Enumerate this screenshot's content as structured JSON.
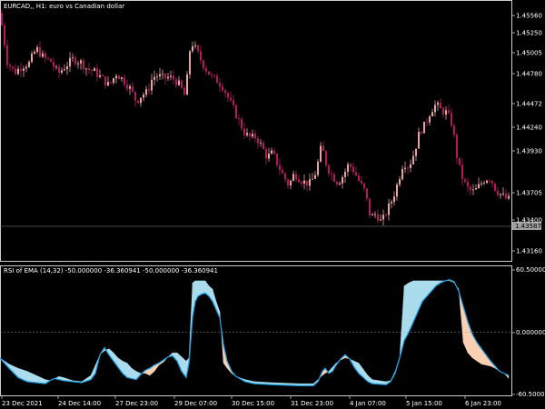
{
  "header": {
    "main_title": "EURCAD,, H1:  euro vs Canadian dollar",
    "indicator_title": "RSI of EMA (14,32) -50.000000 -36.360941 -50.000000 -36.360941"
  },
  "price_axis": {
    "labels": [
      "1.45560",
      "1.45250",
      "1.45005",
      "1.44780",
      "1.44472",
      "1.44240",
      "1.43930",
      "1.43705",
      "1.43400",
      "1.43160"
    ],
    "last_price": "1.43587"
  },
  "indicator_axis": {
    "labels": [
      "60.500000",
      "0.000000",
      "-60.500000"
    ]
  },
  "time_axis": {
    "labels": [
      "23 Dec 2021",
      "24 Dec 14:00",
      "27 Dec 23:00",
      "29 Dec 07:00",
      "30 Dec 15:00",
      "31 Dec 23:00",
      "4 Jan 07:00",
      "5 Jan 15:00",
      "6 Jan 23:00"
    ]
  },
  "colors": {
    "background": "#000000",
    "grid": "#333333",
    "axis": "#ffffff",
    "bull_candle": "#e8a2a2",
    "bear_candle": "#b3185c",
    "rsi_line": "#1c9fe0",
    "rsi_line_secondary": "#f5b283",
    "cloud_up": "#aadcec",
    "cloud_down": "#fbd0b3",
    "price_line": "#8a8a8a",
    "price_tag": "#a0a0a0"
  },
  "chart_data": [
    {
      "type": "candlestick",
      "title": "EURCAD,, H1:  euro vs Canadian dollar",
      "ylim": [
        1.4295,
        1.4572
      ],
      "price_anchors": [
        [
          0,
          1.456
        ],
        [
          8,
          1.4508
        ],
        [
          16,
          1.4496
        ],
        [
          24,
          1.4503
        ],
        [
          32,
          1.4506
        ],
        [
          40,
          1.4522
        ],
        [
          48,
          1.4512
        ],
        [
          56,
          1.4508
        ],
        [
          64,
          1.4495
        ],
        [
          72,
          1.4503
        ],
        [
          80,
          1.451
        ],
        [
          88,
          1.4508
        ],
        [
          96,
          1.45
        ],
        [
          104,
          1.4497
        ],
        [
          112,
          1.449
        ],
        [
          120,
          1.4482
        ],
        [
          128,
          1.4495
        ],
        [
          136,
          1.4488
        ],
        [
          144,
          1.4478
        ],
        [
          150,
          1.4465
        ],
        [
          156,
          1.4472
        ],
        [
          162,
          1.4475
        ],
        [
          168,
          1.4491
        ],
        [
          174,
          1.4493
        ],
        [
          180,
          1.449
        ],
        [
          186,
          1.4491
        ],
        [
          192,
          1.4489
        ],
        [
          198,
          1.4482
        ],
        [
          204,
          1.447
        ],
        [
          210,
          1.453
        ],
        [
          216,
          1.452
        ],
        [
          222,
          1.4508
        ],
        [
          228,
          1.4498
        ],
        [
          234,
          1.449
        ],
        [
          240,
          1.4487
        ],
        [
          246,
          1.448
        ],
        [
          252,
          1.4467
        ],
        [
          258,
          1.4455
        ],
        [
          264,
          1.4442
        ],
        [
          270,
          1.443
        ],
        [
          276,
          1.4426
        ],
        [
          282,
          1.4427
        ],
        [
          288,
          1.4417
        ],
        [
          294,
          1.4405
        ],
        [
          300,
          1.441
        ],
        [
          306,
          1.4397
        ],
        [
          312,
          1.4385
        ],
        [
          318,
          1.4375
        ],
        [
          324,
          1.4388
        ],
        [
          330,
          1.4382
        ],
        [
          336,
          1.4378
        ],
        [
          342,
          1.4377
        ],
        [
          348,
          1.439
        ],
        [
          354,
          1.4418
        ],
        [
          360,
          1.4395
        ],
        [
          366,
          1.4385
        ],
        [
          372,
          1.4378
        ],
        [
          378,
          1.4386
        ],
        [
          384,
          1.4398
        ],
        [
          390,
          1.439
        ],
        [
          396,
          1.4378
        ],
        [
          402,
          1.4368
        ],
        [
          408,
          1.434
        ],
        [
          414,
          1.4345
        ],
        [
          420,
          1.4335
        ],
        [
          426,
          1.4348
        ],
        [
          432,
          1.436
        ],
        [
          438,
          1.4378
        ],
        [
          444,
          1.44
        ],
        [
          450,
          1.4395
        ],
        [
          456,
          1.441
        ],
        [
          462,
          1.4433
        ],
        [
          468,
          1.444
        ],
        [
          474,
          1.4455
        ],
        [
          480,
          1.4462
        ],
        [
          486,
          1.4455
        ],
        [
          492,
          1.4453
        ],
        [
          498,
          1.444
        ],
        [
          504,
          1.44
        ],
        [
          510,
          1.438
        ],
        [
          516,
          1.437
        ],
        [
          522,
          1.4368
        ],
        [
          528,
          1.4375
        ],
        [
          534,
          1.4382
        ],
        [
          540,
          1.4383
        ],
        [
          546,
          1.437
        ],
        [
          552,
          1.4365
        ],
        [
          558,
          1.436
        ]
      ]
    },
    {
      "type": "area",
      "title": "RSI of EMA (14,32) -50.000000 -36.360941 -50.000000 -36.360941",
      "ylim": [
        -60.5,
        60.5
      ],
      "reference_line": 0,
      "series": [
        {
          "values": [
            [
              0,
              -25
            ],
            [
              10,
              -35
            ],
            [
              20,
              -44
            ],
            [
              30,
              -48
            ],
            [
              40,
              -49
            ],
            [
              50,
              -50
            ],
            [
              55,
              -47
            ],
            [
              60,
              -45
            ],
            [
              65,
              -46
            ],
            [
              70,
              -47
            ],
            [
              80,
              -48
            ],
            [
              90,
              -49
            ],
            [
              100,
              -46
            ],
            [
              105,
              -40
            ],
            [
              110,
              -22
            ],
            [
              115,
              -15
            ],
            [
              120,
              -22
            ],
            [
              125,
              -28
            ],
            [
              130,
              -34
            ],
            [
              135,
              -40
            ],
            [
              140,
              -44
            ],
            [
              145,
              -45
            ],
            [
              150,
              -46
            ],
            [
              155,
              -41
            ],
            [
              160,
              -37
            ],
            [
              165,
              -35
            ],
            [
              170,
              -32
            ],
            [
              175,
              -30
            ],
            [
              180,
              -27
            ],
            [
              185,
              -24
            ],
            [
              190,
              -23
            ],
            [
              195,
              -28
            ],
            [
              200,
              -38
            ],
            [
              205,
              -44
            ],
            [
              208,
              -30
            ],
            [
              212,
              15
            ],
            [
              215,
              30
            ],
            [
              218,
              35
            ],
            [
              222,
              37
            ],
            [
              226,
              38
            ],
            [
              230,
              35
            ],
            [
              234,
              30
            ],
            [
              238,
              22
            ],
            [
              242,
              14
            ],
            [
              246,
              -12
            ],
            [
              250,
              -28
            ],
            [
              255,
              -38
            ],
            [
              260,
              -43
            ],
            [
              270,
              -48
            ],
            [
              280,
              -50
            ],
            [
              300,
              -51
            ],
            [
              330,
              -52
            ],
            [
              345,
              -52
            ],
            [
              350,
              -48
            ],
            [
              355,
              -38
            ],
            [
              358,
              -35
            ],
            [
              362,
              -40
            ],
            [
              366,
              -38
            ],
            [
              370,
              -32
            ],
            [
              375,
              -26
            ],
            [
              380,
              -22
            ],
            [
              385,
              -26
            ],
            [
              390,
              -34
            ],
            [
              395,
              -40
            ],
            [
              400,
              -44
            ],
            [
              405,
              -48
            ],
            [
              410,
              -50
            ],
            [
              425,
              -51
            ],
            [
              430,
              -48
            ],
            [
              435,
              -40
            ],
            [
              440,
              -25
            ],
            [
              445,
              -8
            ],
            [
              450,
              0
            ],
            [
              455,
              10
            ],
            [
              460,
              20
            ],
            [
              465,
              30
            ],
            [
              470,
              35
            ],
            [
              475,
              40
            ],
            [
              480,
              45
            ],
            [
              485,
              48
            ],
            [
              490,
              50
            ],
            [
              495,
              51
            ],
            [
              500,
              49
            ],
            [
              505,
              40
            ],
            [
              510,
              25
            ],
            [
              515,
              10
            ],
            [
              520,
              -2
            ],
            [
              525,
              -10
            ],
            [
              530,
              -16
            ],
            [
              535,
              -22
            ],
            [
              540,
              -28
            ],
            [
              545,
              -33
            ],
            [
              550,
              -38
            ],
            [
              555,
              -40
            ],
            [
              560,
              -42
            ]
          ]
        },
        {
          "values": [
            [
              0,
              -25
            ],
            [
              10,
              -31
            ],
            [
              20,
              -35
            ],
            [
              30,
              -38
            ],
            [
              40,
              -42
            ],
            [
              50,
              -46
            ],
            [
              55,
              -47
            ],
            [
              60,
              -45
            ],
            [
              65,
              -43
            ],
            [
              70,
              -44
            ],
            [
              80,
              -47
            ],
            [
              90,
              -48
            ],
            [
              100,
              -42
            ],
            [
              105,
              -32
            ],
            [
              110,
              -22
            ],
            [
              115,
              -18
            ],
            [
              120,
              -16
            ],
            [
              125,
              -20
            ],
            [
              130,
              -25
            ],
            [
              135,
              -28
            ],
            [
              140,
              -30
            ],
            [
              145,
              -35
            ],
            [
              150,
              -38
            ],
            [
              155,
              -40
            ],
            [
              160,
              -40
            ],
            [
              165,
              -42
            ],
            [
              170,
              -38
            ],
            [
              175,
              -32
            ],
            [
              180,
              -29
            ],
            [
              185,
              -24
            ],
            [
              190,
              -20
            ],
            [
              195,
              -20
            ],
            [
              200,
              -24
            ],
            [
              205,
              -28
            ],
            [
              208,
              -25
            ],
            [
              212,
              48
            ],
            [
              215,
              50
            ],
            [
              218,
              50
            ],
            [
              222,
              50
            ],
            [
              226,
              50
            ],
            [
              230,
              45
            ],
            [
              234,
              42
            ],
            [
              238,
              30
            ],
            [
              242,
              20
            ],
            [
              246,
              -30
            ],
            [
              250,
              -35
            ],
            [
              255,
              -40
            ],
            [
              260,
              -43
            ],
            [
              270,
              -46
            ],
            [
              280,
              -48
            ],
            [
              300,
              -49
            ],
            [
              330,
              -50
            ],
            [
              345,
              -50
            ],
            [
              350,
              -46
            ],
            [
              355,
              -42
            ],
            [
              358,
              -40
            ],
            [
              362,
              -38
            ],
            [
              366,
              -34
            ],
            [
              370,
              -30
            ],
            [
              375,
              -27
            ],
            [
              380,
              -25
            ],
            [
              385,
              -26
            ],
            [
              390,
              -28
            ],
            [
              395,
              -30
            ],
            [
              400,
              -36
            ],
            [
              405,
              -42
            ],
            [
              410,
              -46
            ],
            [
              425,
              -48
            ],
            [
              430,
              -47
            ],
            [
              435,
              -38
            ],
            [
              440,
              -24
            ],
            [
              445,
              45
            ],
            [
              450,
              48
            ],
            [
              455,
              50
            ],
            [
              460,
              50
            ],
            [
              465,
              50
            ],
            [
              470,
              50
            ],
            [
              475,
              50
            ],
            [
              480,
              50
            ],
            [
              485,
              50
            ],
            [
              490,
              50
            ],
            [
              495,
              50
            ],
            [
              500,
              48
            ],
            [
              505,
              42
            ],
            [
              510,
              -10
            ],
            [
              515,
              -20
            ],
            [
              520,
              -25
            ],
            [
              525,
              -28
            ],
            [
              530,
              -31
            ],
            [
              535,
              -32
            ],
            [
              540,
              -33
            ],
            [
              545,
              -35
            ],
            [
              550,
              -38
            ],
            [
              555,
              -40
            ],
            [
              560,
              -45
            ]
          ]
        }
      ]
    }
  ]
}
